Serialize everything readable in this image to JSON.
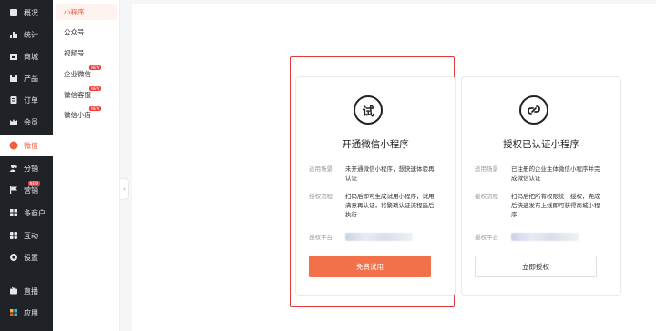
{
  "nav": {
    "items": [
      {
        "label": "概况",
        "icon": "home-icon"
      },
      {
        "label": "统计",
        "icon": "bar-chart-icon"
      },
      {
        "label": "商城",
        "icon": "store-icon"
      },
      {
        "label": "产品",
        "icon": "box-icon"
      },
      {
        "label": "订单",
        "icon": "order-icon"
      },
      {
        "label": "会员",
        "icon": "crown-icon"
      },
      {
        "label": "微信",
        "icon": "wechat-icon",
        "active": true
      },
      {
        "label": "分销",
        "icon": "people-icon"
      },
      {
        "label": "营销",
        "icon": "flag-icon",
        "badge": "NEW"
      },
      {
        "label": "多商户",
        "icon": "shop-grid-icon"
      },
      {
        "label": "互动",
        "icon": "apps-icon"
      },
      {
        "label": "设置",
        "icon": "gear-icon"
      },
      {
        "label": "直播",
        "icon": "tv-icon"
      },
      {
        "label": "应用",
        "icon": "colorful-apps-icon"
      }
    ]
  },
  "subnav": {
    "items": [
      {
        "label": "小程序",
        "active": true
      },
      {
        "label": "公众号"
      },
      {
        "label": "视频号"
      },
      {
        "label": "企业微信",
        "badge": "NEW"
      },
      {
        "label": "微信客服",
        "badge": "NEW"
      },
      {
        "label": "微信小店",
        "badge": "NEW"
      }
    ]
  },
  "cards": [
    {
      "logo_text": "试",
      "title": "开通微信小程序",
      "scene_label": "适用场景",
      "scene_value": "未开通微信小程序，想快速体验再认证",
      "flow_label": "授权流程",
      "flow_value": "扫码后即可生成试用小程序，试用满意再认证，将繁琐认证流程延后执行",
      "platform_label": "授权平台",
      "button_label": "免费试用"
    },
    {
      "logo_text": "∂",
      "title": "授权已认证小程序",
      "scene_label": "适用场景",
      "scene_value": "已注册的企业主体微信小程序并完成微信认证",
      "flow_label": "授权流程",
      "flow_value": "扫码后把所有权限统一授权，完成后快速发布上线即可获得商城小程序",
      "platform_label": "授权平台",
      "button_label": "立即授权"
    }
  ],
  "colors": {
    "accent": "#f2714b",
    "highlight_border": "#e23a3a",
    "nav_bg": "#1f2227"
  }
}
